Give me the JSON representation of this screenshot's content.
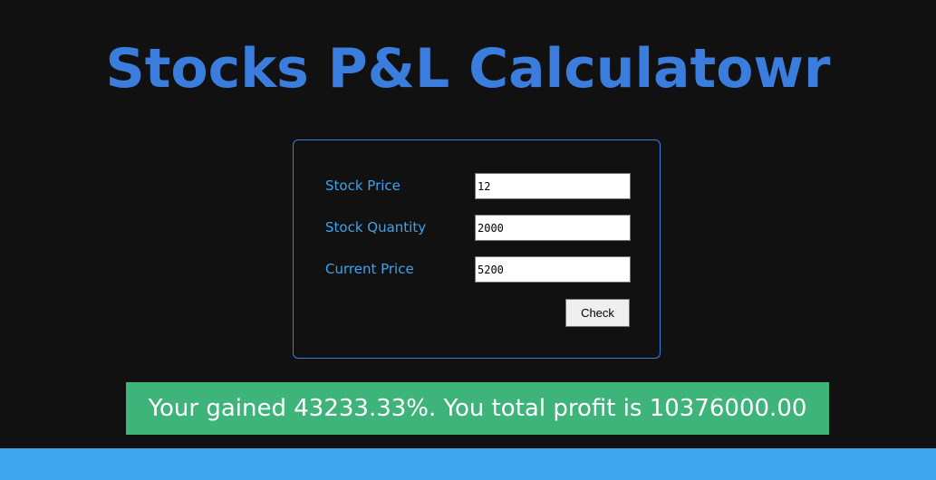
{
  "header": {
    "title": "Stocks P&L Calculatowr"
  },
  "form": {
    "stock_price": {
      "label": "Stock Price",
      "value": "12"
    },
    "stock_quantity": {
      "label": "Stock Quantity",
      "value": "2000"
    },
    "current_price": {
      "label": "Current Price",
      "value": "5200"
    },
    "check_button_label": "Check"
  },
  "output": {
    "message": "Your gained 43233.33%. You total profit is 10376000.00"
  },
  "colors": {
    "background": "#111111",
    "accent": "#3b7ddd",
    "label": "#3ea3ee",
    "result_bg": "#3fb47a",
    "footer": "#3ea6ec"
  }
}
